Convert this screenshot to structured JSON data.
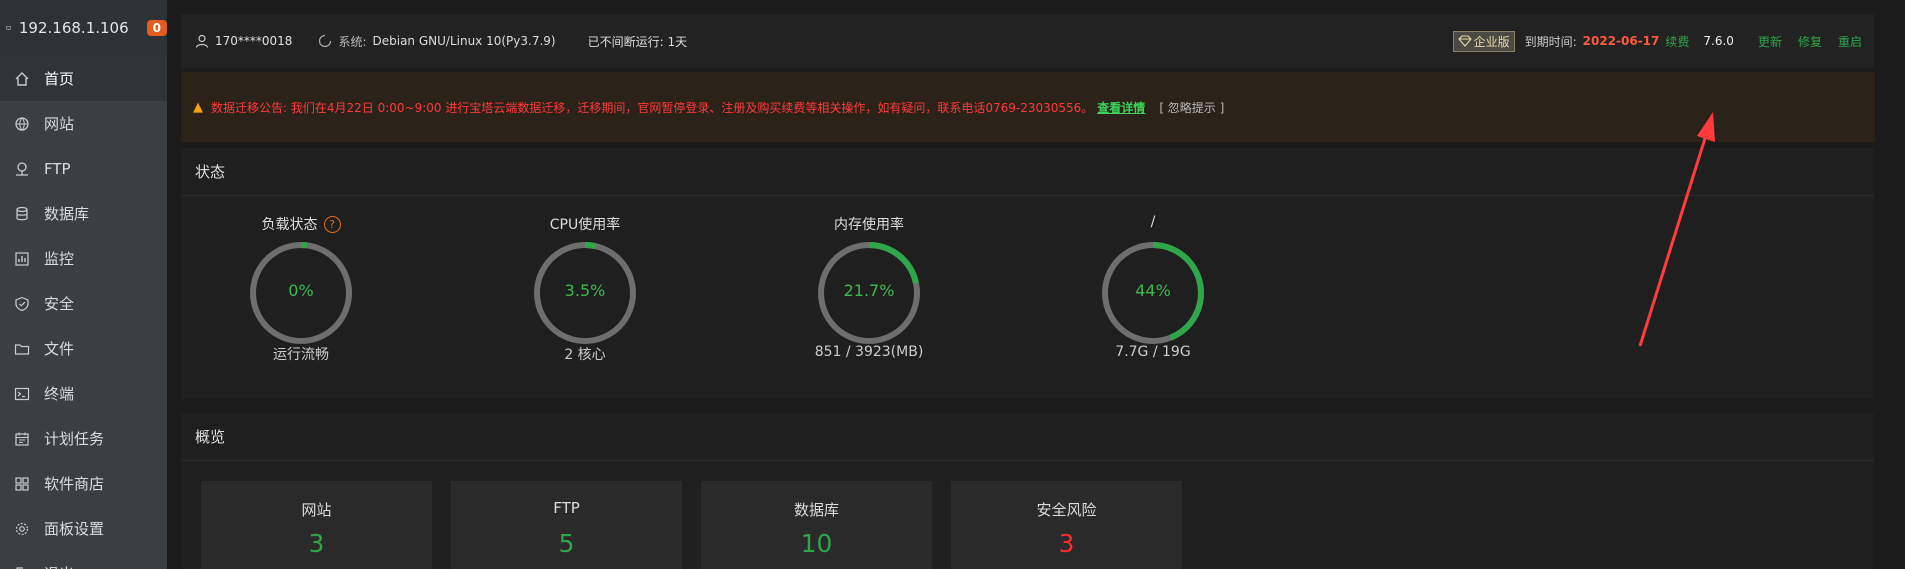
{
  "sidebar": {
    "host": "192.168.1.106",
    "badge": "0",
    "items": [
      {
        "label": "首页",
        "icon": "home-icon"
      },
      {
        "label": "网站",
        "icon": "globe-icon"
      },
      {
        "label": "FTP",
        "icon": "ftp-icon"
      },
      {
        "label": "数据库",
        "icon": "database-icon"
      },
      {
        "label": "监控",
        "icon": "monitor-chart-icon"
      },
      {
        "label": "安全",
        "icon": "shield-icon"
      },
      {
        "label": "文件",
        "icon": "folder-icon"
      },
      {
        "label": "终端",
        "icon": "terminal-icon"
      },
      {
        "label": "计划任务",
        "icon": "calendar-icon"
      },
      {
        "label": "软件商店",
        "icon": "grid-icon"
      },
      {
        "label": "面板设置",
        "icon": "gear-icon"
      },
      {
        "label": "退出",
        "icon": "logout-icon"
      }
    ]
  },
  "topbar": {
    "user": "170****0018",
    "system_label": "系统:",
    "system": "Debian GNU/Linux 10(Py3.7.9)",
    "uptime": "已不间断运行: 1天",
    "edition": "企业版",
    "expire_label": "到期时间:",
    "expire_date": "2022-06-17",
    "renew": "续费",
    "version": "7.6.0",
    "update": "更新",
    "repair": "修复",
    "restart": "重启"
  },
  "notice": {
    "text": "数据迁移公告: 我们在4月22日 0:00~9:00 进行宝塔云端数据迁移，迁移期间，官网暂停登录、注册及购买续费等相关操作，如有疑问，联系电话0769-23030556。",
    "link": "查看详情",
    "ignore": "[ 忽略提示 ]"
  },
  "status": {
    "title": "状态",
    "gauges": [
      {
        "title": "负载状态",
        "value": "0%",
        "pct": 0.02,
        "sub": "运行流畅",
        "help": "?"
      },
      {
        "title": "CPU使用率",
        "value": "3.5%",
        "pct": 0.035,
        "sub": "2 核心"
      },
      {
        "title": "内存使用率",
        "value": "21.7%",
        "pct": 0.217,
        "sub": "851 / 3923(MB)"
      },
      {
        "title": "/",
        "value": "44%",
        "pct": 0.44,
        "sub": "7.7G / 19G"
      }
    ]
  },
  "overview": {
    "title": "概览",
    "cards": [
      {
        "label": "网站",
        "value": "3"
      },
      {
        "label": "FTP",
        "value": "5"
      },
      {
        "label": "数据库",
        "value": "10"
      },
      {
        "label": "安全风险",
        "value": "3"
      }
    ]
  },
  "colors": {
    "accent_green": "#2ea64a",
    "danger_red": "#ff2d2d",
    "expire_red": "#ff5a3c",
    "sidebar_bg": "#3a3f44"
  }
}
